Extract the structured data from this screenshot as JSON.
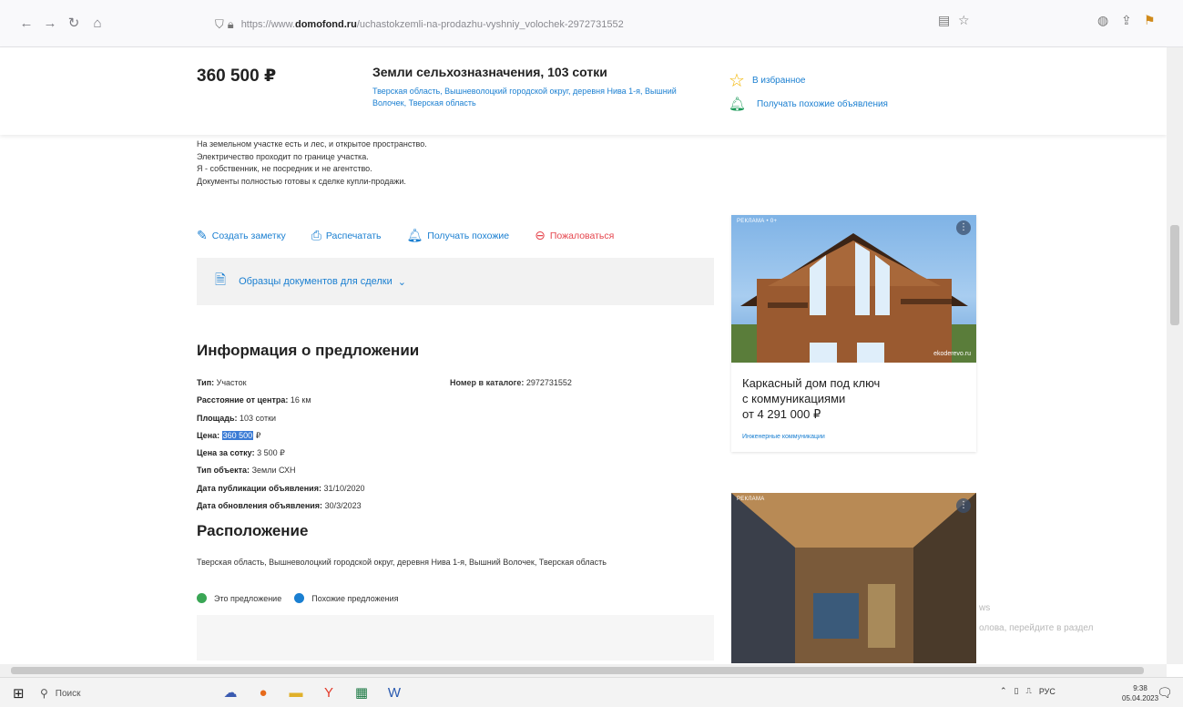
{
  "browser": {
    "url_prefix": "https://www.",
    "url_domain": "domofond.ru",
    "url_path": "/uchastokzemli-na-prodazhu-vyshniy_volochek-2972731552"
  },
  "header": {
    "price": "360 500 ₽",
    "title": "Земли сельхозназначения, 103 сотки",
    "address": "Тверская область, Вышневолоцкий городской округ, деревня Нива 1-я, Вышний Волочек, Тверская область",
    "favorite_label": "В избранное",
    "similar_label": "Получать похожие объявления"
  },
  "description": {
    "lines": [
      "На земельном участке есть и лес, и открытое пространство.",
      "Электричество проходит по границе участка.",
      "Я - собственник, не посредник и не агентство.",
      "Документы полностью готовы к сделке купли-продажи."
    ]
  },
  "actions": {
    "note": "Создать заметку",
    "print": "Распечатать",
    "similar": "Получать похожие",
    "report": "Пожаловаться"
  },
  "docs": {
    "label": "Образцы документов для сделки"
  },
  "info": {
    "heading": "Информация о предложении",
    "type_label": "Тип:",
    "type_value": "Участок",
    "distance_label": "Расстояние от центра:",
    "distance_value": "16 км",
    "area_label": "Площадь:",
    "area_value": "103 сотки",
    "price_label": "Цена:",
    "price_value": "360 500",
    "price_currency": "₽",
    "price_per_label": "Цена за сотку:",
    "price_per_value": "3 500 ₽",
    "object_label": "Тип объекта:",
    "object_value": "Земли СХН",
    "published_label": "Дата публикации объявления:",
    "published_value": "31/10/2020",
    "updated_label": "Дата обновления объявления:",
    "updated_value": "30/3/2023",
    "catalog_label": "Номер в каталоге:",
    "catalog_value": "2972731552"
  },
  "location": {
    "heading": "Расположение",
    "address": "Тверская область, Вышневолоцкий городской округ, деревня Нива 1-я, Вышний Волочек, Тверская область",
    "legend_this": "Это предложение",
    "legend_similar": "Похожие предложения",
    "color_this": "#3aa655",
    "color_similar": "#1a7fd1"
  },
  "ads": {
    "ad1_label": "РЕКЛАМА • 0+",
    "ad1_site": "ekoderevo.ru",
    "ad1_line1": "Каркасный дом под ключ",
    "ad1_line2": "с коммуникациями",
    "ad1_line3": "от 4 291 000 ₽",
    "ad1_tag": "Инженерные коммуникации",
    "ad2_label": "РЕКЛАМА"
  },
  "watermark": {
    "line1": "ws",
    "line2": "олова, перейдите в раздел"
  },
  "taskbar": {
    "search_placeholder": "Поиск",
    "lang": "РУС",
    "time": "9:38",
    "date": "05.04.2023"
  }
}
